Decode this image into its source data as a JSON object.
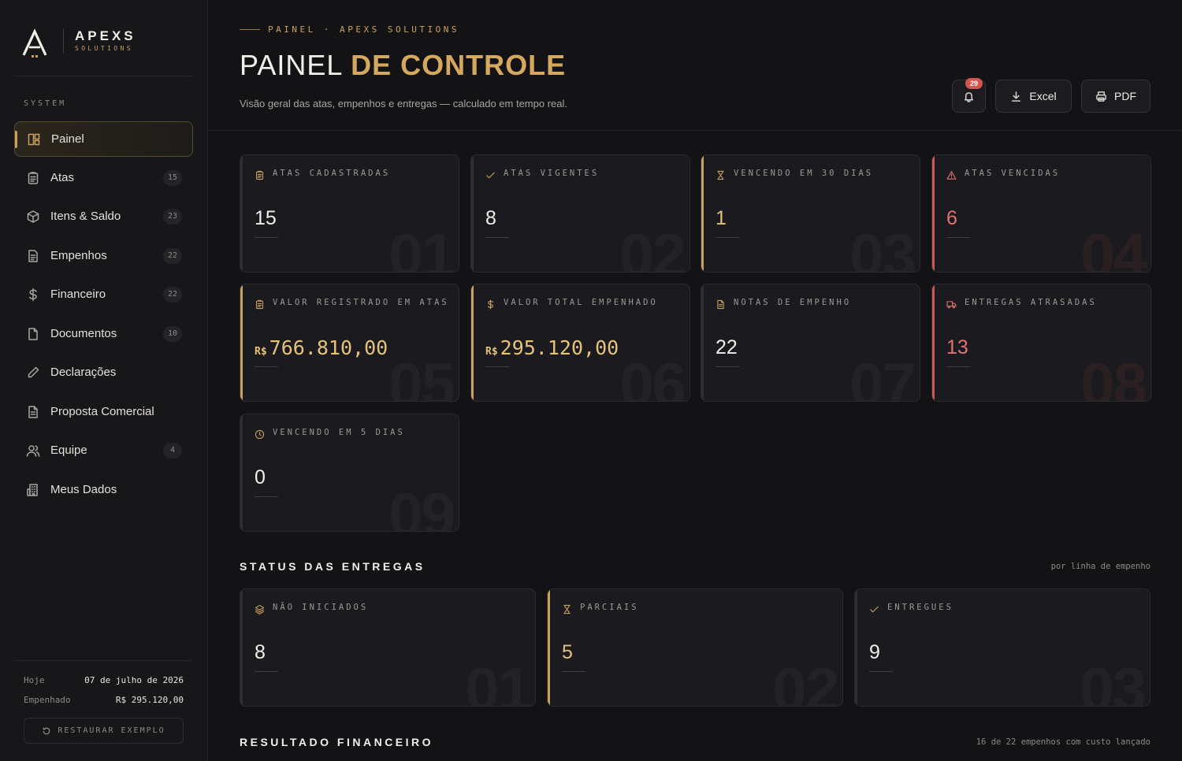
{
  "brand": {
    "name": "APEXS",
    "sub": "SOLUTIONS"
  },
  "sidebar": {
    "section": "SYSTEM",
    "items": [
      {
        "label": "Painel",
        "badge": "",
        "icon": "layout-icon",
        "active": true
      },
      {
        "label": "Atas",
        "badge": "15",
        "icon": "clipboard-icon"
      },
      {
        "label": "Itens & Saldo",
        "badge": "23",
        "icon": "box-icon"
      },
      {
        "label": "Empenhos",
        "badge": "22",
        "icon": "document-lines-icon"
      },
      {
        "label": "Financeiro",
        "badge": "22",
        "icon": "dollar-icon"
      },
      {
        "label": "Documentos",
        "badge": "10",
        "icon": "file-icon"
      },
      {
        "label": "Declarações",
        "badge": "",
        "icon": "pencil-icon"
      },
      {
        "label": "Proposta Comercial",
        "badge": "",
        "icon": "file-text-icon"
      },
      {
        "label": "Equipe",
        "badge": "4",
        "icon": "users-icon"
      },
      {
        "label": "Meus Dados",
        "badge": "",
        "icon": "building-icon"
      }
    ],
    "footer": {
      "today_label": "Hoje",
      "today_value": "07 de julho de 2026",
      "committed_label": "Empenhado",
      "committed_value": "R$ 295.120,00",
      "restore_label": "RESTAURAR EXEMPLO"
    }
  },
  "header": {
    "eyebrow": "PAINEL · APEXS SOLUTIONS",
    "title_plain": "PAINEL",
    "title_accent": "DE CONTROLE",
    "subtitle": "Visão geral das atas, empenhos e entregas — calculado em tempo real.",
    "notifications": "29",
    "excel_label": "Excel",
    "pdf_label": "PDF"
  },
  "stats": [
    {
      "label": "ATAS CADASTRADAS",
      "value": "15",
      "num": "01",
      "tone": "neutral",
      "icon": "clipboard-icon"
    },
    {
      "label": "ATAS VIGENTES",
      "value": "8",
      "num": "02",
      "tone": "neutral",
      "icon": "check-icon"
    },
    {
      "label": "VENCENDO EM 30 DIAS",
      "value": "1",
      "num": "03",
      "tone": "gold",
      "icon": "hourglass-icon"
    },
    {
      "label": "ATAS VENCIDAS",
      "value": "6",
      "num": "04",
      "tone": "red",
      "icon": "warning-icon"
    },
    {
      "label": "VALOR REGISTRADO EM ATAS",
      "currency": "R$",
      "value": "766.810,00",
      "num": "05",
      "tone": "gold",
      "icon": "clipboard-icon"
    },
    {
      "label": "VALOR TOTAL EMPENHADO",
      "currency": "R$",
      "value": "295.120,00",
      "num": "06",
      "tone": "gold",
      "icon": "dollar-icon"
    },
    {
      "label": "NOTAS DE EMPENHO",
      "value": "22",
      "num": "07",
      "tone": "neutral",
      "icon": "file-text-icon"
    },
    {
      "label": "ENTREGAS ATRASADAS",
      "value": "13",
      "num": "08",
      "tone": "red",
      "icon": "truck-icon"
    },
    {
      "label": "VENCENDO EM 5 DIAS",
      "value": "0",
      "num": "09",
      "tone": "neutral",
      "icon": "clock-icon"
    }
  ],
  "deliveries": {
    "title": "STATUS DAS ENTREGAS",
    "note": "por linha de empenho",
    "cards": [
      {
        "label": "NÃO INICIADOS",
        "value": "8",
        "num": "01",
        "tone": "neutral",
        "icon": "layers-icon"
      },
      {
        "label": "PARCIAIS",
        "value": "5",
        "num": "02",
        "tone": "gold",
        "icon": "hourglass-icon"
      },
      {
        "label": "ENTREGUES",
        "value": "9",
        "num": "03",
        "tone": "neutral",
        "icon": "check-icon"
      }
    ]
  },
  "financial": {
    "title": "RESULTADO FINANCEIRO",
    "note": "16 de 22 empenhos com custo lançado"
  },
  "colors": {
    "accent": "#c9a15e",
    "danger": "#e0736c",
    "background": "#131316"
  }
}
